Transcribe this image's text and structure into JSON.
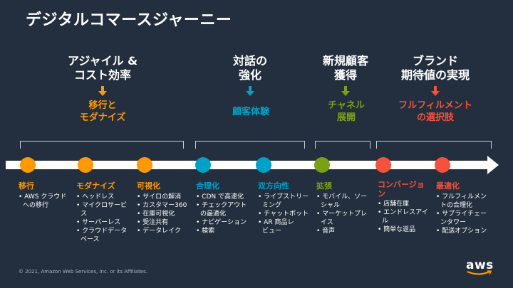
{
  "title": "デジタルコマースジャーニー",
  "colors": {
    "orange": "#ff9900",
    "blue": "#00a1c9",
    "green": "#7aa116",
    "red": "#f5513d",
    "background": "#232f3e"
  },
  "groups": [
    {
      "heading": "アジャイル &\nコスト効率",
      "sub": "移行と\nモダナイズ"
    },
    {
      "heading": "対話の\n強化",
      "sub": "顧客体験"
    },
    {
      "heading": "新規顧客\n獲得",
      "sub": "チャネル\n展開"
    },
    {
      "heading": "ブランド\n期待値の実現",
      "sub": "フルフィルメント\nの選択肢"
    }
  ],
  "stages": [
    {
      "title": "移行",
      "items": [
        "AWS クラウド\nへの移行"
      ]
    },
    {
      "title": "モダナイズ",
      "items": [
        "ヘッドレス",
        "マイクロサービ\nス",
        "サーバーレス",
        "クラウドデータ\nベース"
      ]
    },
    {
      "title": "可視化",
      "items": [
        "サイロの解消",
        "カスタマー360",
        "在庫可視化",
        "受注共有",
        "データレイク"
      ]
    },
    {
      "title": "合理化",
      "items": [
        "CDN で高速化",
        "チェックアウト\nの最適化",
        "ナビゲーション",
        "検索"
      ]
    },
    {
      "title": "双方向性",
      "items": [
        "ライブストリー\nミング",
        "チャットボット",
        "AR 商品レ\nビュー"
      ]
    },
    {
      "title": "拡張",
      "items": [
        "モバイル、ソー\nシャル",
        "マーケットプレ\nイス",
        "音声"
      ]
    },
    {
      "title": "コンバージョ\nン",
      "items": [
        "店舗在庫",
        "エンドレスアイ\nル",
        "簡単な返品"
      ]
    },
    {
      "title": "最適化",
      "items": [
        "フルフィルメン\nトの合理化",
        "サプライチェー\nンタワー",
        "配送オプション"
      ]
    }
  ],
  "copyright": "© 2021, Amazon Web Services, Inc. or its Affiliates.",
  "logo": "aws"
}
